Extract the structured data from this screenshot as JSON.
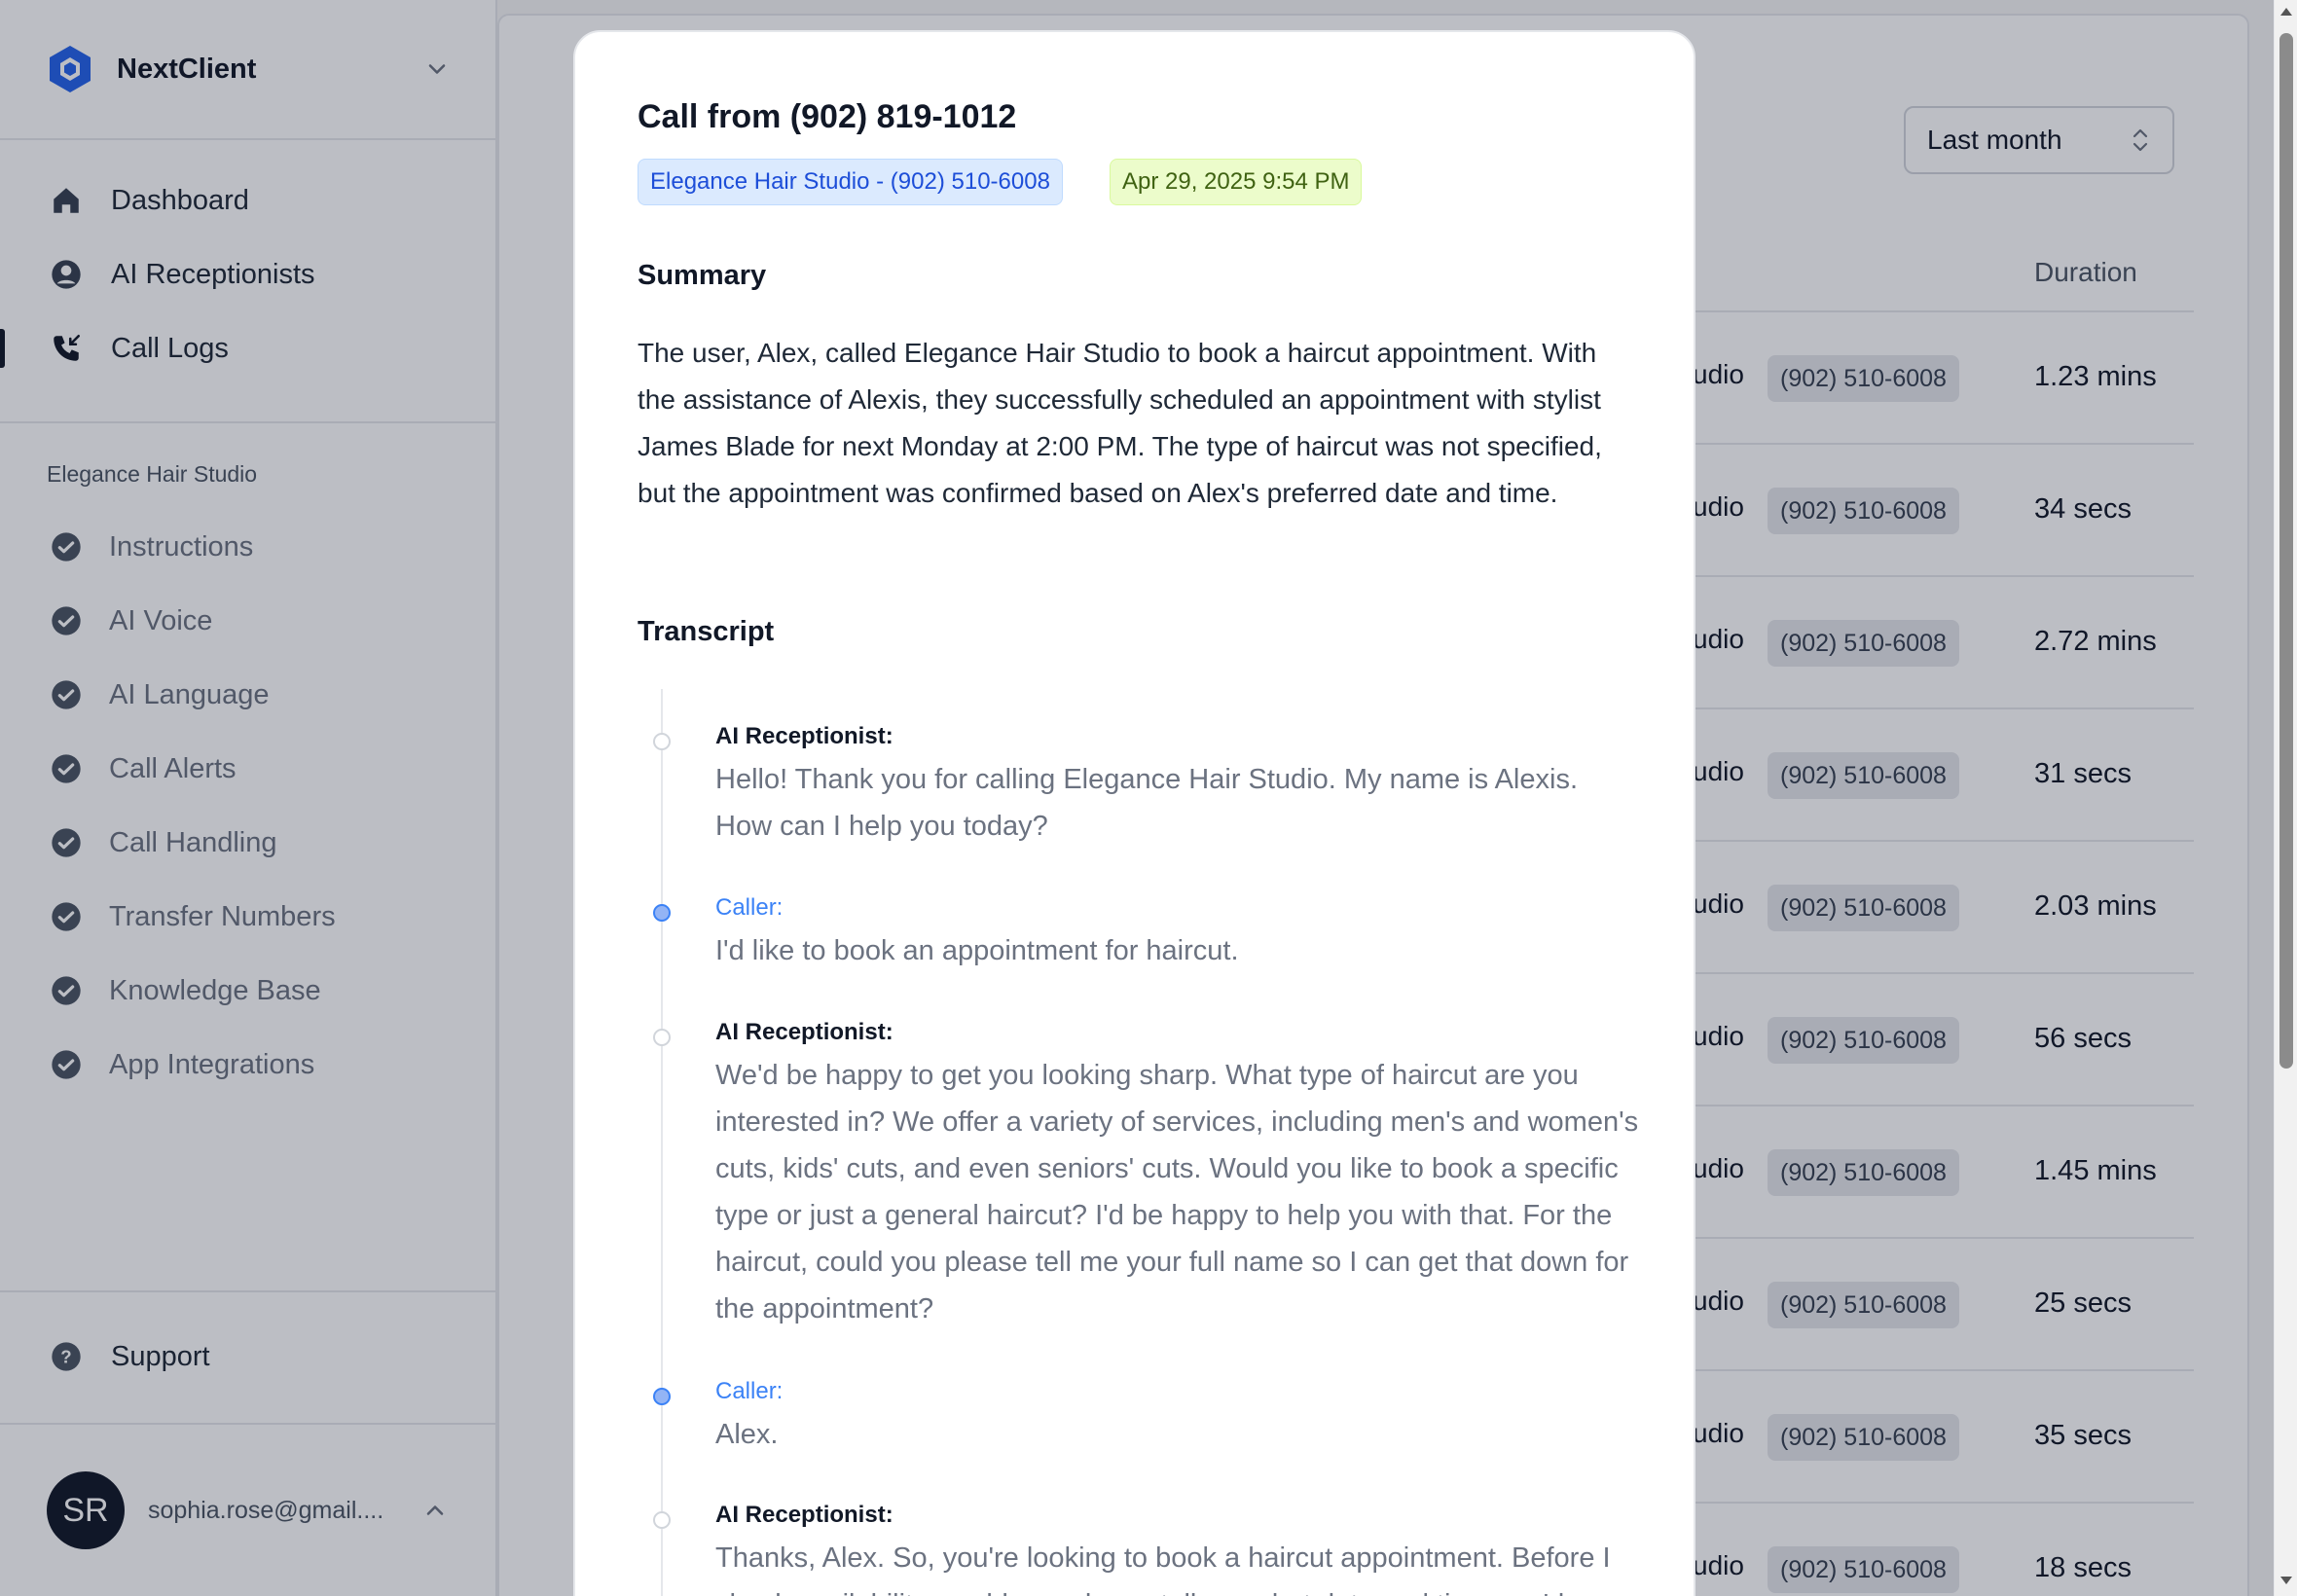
{
  "app": {
    "org_name": "NextClient",
    "brand_color": "#2563eb"
  },
  "sidebar": {
    "main_items": [
      {
        "label": "Dashboard",
        "icon": "home-icon"
      },
      {
        "label": "AI Receptionists",
        "icon": "user-circle-icon"
      },
      {
        "label": "Call Logs",
        "icon": "phone-incoming-icon",
        "active": true
      }
    ],
    "section_label": "Elegance Hair Studio",
    "sub_items": [
      {
        "label": "Instructions",
        "icon": "check-circle-icon"
      },
      {
        "label": "AI Voice",
        "icon": "check-circle-icon"
      },
      {
        "label": "AI Language",
        "icon": "check-circle-icon"
      },
      {
        "label": "Call Alerts",
        "icon": "check-circle-icon"
      },
      {
        "label": "Call Handling",
        "icon": "check-circle-icon"
      },
      {
        "label": "Transfer Numbers",
        "icon": "check-circle-icon"
      },
      {
        "label": "Knowledge Base",
        "icon": "check-circle-icon"
      },
      {
        "label": "App Integrations",
        "icon": "check-circle-icon"
      }
    ],
    "support_label": "Support",
    "user": {
      "initials": "SR",
      "email": "sophia.rose@gmail...."
    }
  },
  "main": {
    "period_select": "Last month",
    "duration_header": "Duration",
    "rows": [
      {
        "studio": "udio",
        "phone": "(902) 510-6008",
        "duration": "1.23 mins"
      },
      {
        "studio": "udio",
        "phone": "(902) 510-6008",
        "duration": "34 secs"
      },
      {
        "studio": "udio",
        "phone": "(902) 510-6008",
        "duration": "2.72 mins"
      },
      {
        "studio": "udio",
        "phone": "(902) 510-6008",
        "duration": "31 secs"
      },
      {
        "studio": "udio",
        "phone": "(902) 510-6008",
        "duration": "2.03 mins"
      },
      {
        "studio": "udio",
        "phone": "(902) 510-6008",
        "duration": "56 secs"
      },
      {
        "studio": "udio",
        "phone": "(902) 510-6008",
        "duration": "1.45 mins"
      },
      {
        "studio": "udio",
        "phone": "(902) 510-6008",
        "duration": "25 secs"
      },
      {
        "studio": "udio",
        "phone": "(902) 510-6008",
        "duration": "35 secs"
      },
      {
        "studio": "udio",
        "phone": "(902) 510-6008",
        "duration": "18 secs"
      }
    ]
  },
  "modal": {
    "title": "Call from (902) 819-1012",
    "receptionist_badge": "Elegance Hair Studio - (902) 510-6008",
    "date_badge": "Apr 29, 2025 9:54 PM",
    "summary_heading": "Summary",
    "summary": "The user, Alex, called Elegance Hair Studio to book a haircut appointment. With the assistance of Alexis, they successfully scheduled an appointment with stylist James Blade for next Monday at 2:00 PM. The type of haircut was not specified, but the appointment was confirmed based on Alex's preferred date and time.",
    "transcript_heading": "Transcript",
    "transcript": [
      {
        "speaker": "AI Receptionist:",
        "role": "ai",
        "text": "Hello! Thank you for calling Elegance Hair Studio. My name is Alexis. How can I help you today?"
      },
      {
        "speaker": "Caller:",
        "role": "caller",
        "text": "I'd like to book an appointment for haircut."
      },
      {
        "speaker": "AI Receptionist:",
        "role": "ai",
        "text": "We'd be happy to get you looking sharp. What type of haircut are you interested in? We offer a variety of services, including men's and women's cuts, kids' cuts, and even seniors' cuts. Would you like to book a specific type or just a general haircut? I'd be happy to help you with that. For the haircut, could you please tell me your full name so I can get that down for the appointment?"
      },
      {
        "speaker": "Caller:",
        "role": "caller",
        "text": "Alex."
      },
      {
        "speaker": "AI Receptionist:",
        "role": "ai",
        "text": "Thanks, Alex. So, you're looking to book a haircut appointment. Before I check availability, could you please tell me what date and time you'd"
      }
    ]
  }
}
